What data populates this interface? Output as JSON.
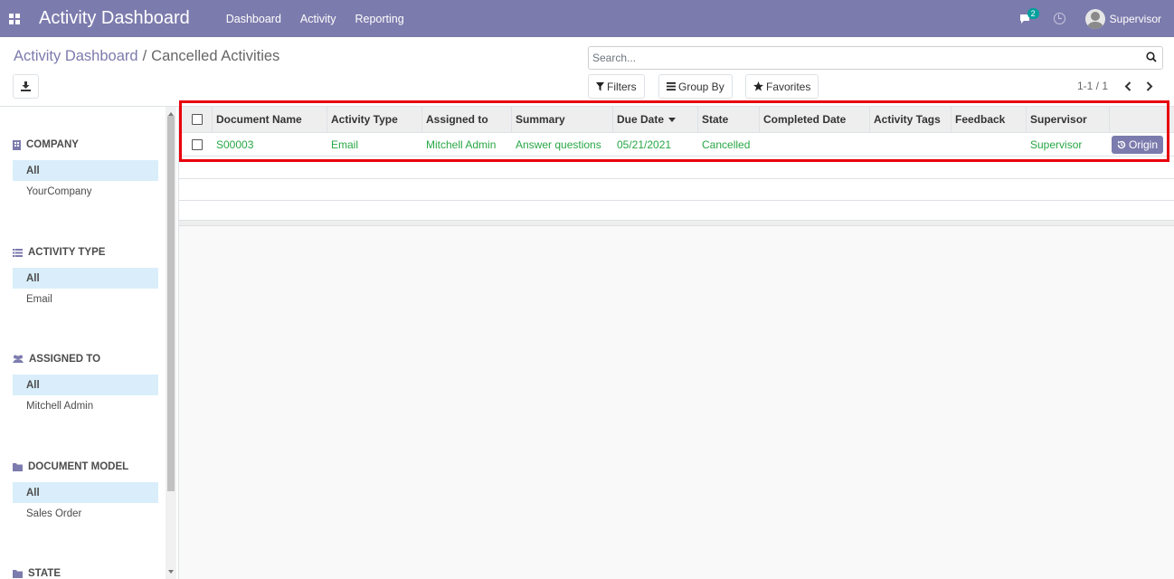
{
  "navbar": {
    "app_title": "Activity Dashboard",
    "menu": [
      "Dashboard",
      "Activity",
      "Reporting"
    ],
    "chat_badge": "2",
    "user_name": "Supervisor"
  },
  "breadcrumb": {
    "parent": "Activity Dashboard",
    "separator": "/",
    "current": "Cancelled Activities"
  },
  "search": {
    "placeholder": "Search..."
  },
  "buttons": {
    "filters": "Filters",
    "group_by": "Group By",
    "favorites": "Favorites"
  },
  "pager": {
    "text": "1-1 / 1"
  },
  "sidebar": {
    "sections": [
      {
        "title": "COMPANY",
        "icon": "building-icon",
        "items": [
          "All",
          "YourCompany"
        ]
      },
      {
        "title": "ACTIVITY TYPE",
        "icon": "list-icon",
        "items": [
          "All",
          "Email"
        ]
      },
      {
        "title": "ASSIGNED TO",
        "icon": "users-icon",
        "items": [
          "All",
          "Mitchell Admin"
        ]
      },
      {
        "title": "DOCUMENT MODEL",
        "icon": "folder-icon",
        "items": [
          "All",
          "Sales Order"
        ]
      },
      {
        "title": "STATE",
        "icon": "folder-icon",
        "items": []
      }
    ]
  },
  "table": {
    "columns": [
      "Document Name",
      "Activity Type",
      "Assigned to",
      "Summary",
      "Due Date",
      "State",
      "Completed Date",
      "Activity Tags",
      "Feedback",
      "Supervisor"
    ],
    "rows": [
      {
        "document_name": "S00003",
        "activity_type": "Email",
        "assigned_to": "Mitchell Admin",
        "summary": "Answer questions",
        "due_date": "05/21/2021",
        "state": "Cancelled",
        "completed_date": "",
        "activity_tags": "",
        "feedback": "",
        "supervisor": "Supervisor",
        "action_label": "Origin"
      }
    ]
  },
  "colors": {
    "navbar": "#7c7bad",
    "link_green": "#28a745",
    "highlight_red": "#e8000b",
    "active_filter": "#d9eefa"
  }
}
